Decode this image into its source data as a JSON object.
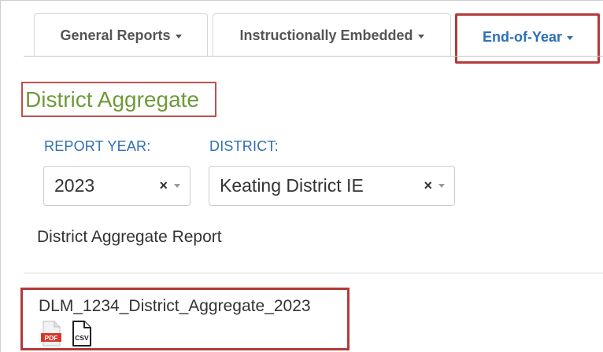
{
  "tabs": [
    {
      "label": "General Reports"
    },
    {
      "label": "Instructionally Embedded"
    },
    {
      "label": "End-of-Year"
    }
  ],
  "page": {
    "title": "District Aggregate"
  },
  "filters": {
    "report_year": {
      "label": "REPORT YEAR:",
      "value": "2023",
      "clear": "×"
    },
    "district": {
      "label": "DISTRICT:",
      "value": "Keating District IE",
      "clear": "×"
    }
  },
  "section": {
    "heading": "District Aggregate Report"
  },
  "report": {
    "name": "DLM_1234_District_Aggregate_2023",
    "pdf_label": "PDF",
    "csv_label": "CSV"
  },
  "colors": {
    "active_tab": "#2e6fb6",
    "title_green": "#6f9a3a",
    "highlight_red": "#b53a3a",
    "pdf_red": "#d9362b"
  }
}
